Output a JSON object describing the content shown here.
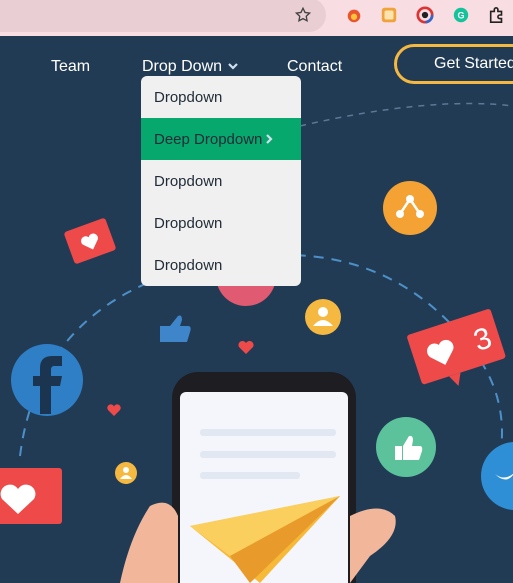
{
  "browser": {
    "bookmark_icon": "star-outline-icon",
    "extensions": [
      "fire-fox-icon",
      "orange-square-icon",
      "color-wheel-icon",
      "grammarly-icon",
      "puzzle-icon"
    ]
  },
  "nav": {
    "team": "Team",
    "dropdown": "Drop Down",
    "contact": "Contact",
    "cta": "Get Started"
  },
  "dropdown_menu": {
    "items": [
      "Dropdown",
      "Deep Dropdown",
      "Dropdown",
      "Dropdown",
      "Dropdown"
    ],
    "active_index": 1
  },
  "hero_art": {
    "badge_count": "3"
  },
  "colors": {
    "background": "#223b55",
    "accent_green": "#07a86d",
    "cta_border": "#f5b942"
  }
}
